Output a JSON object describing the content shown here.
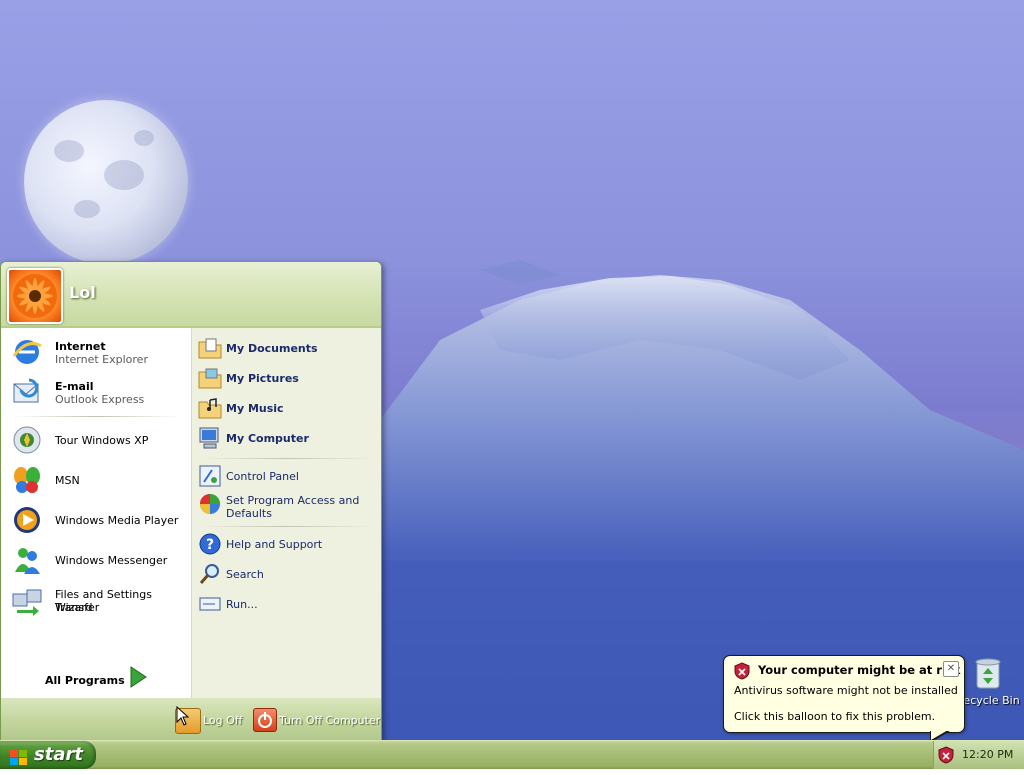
{
  "desktop": {
    "recycle_bin_label": "Recycle Bin"
  },
  "start_menu": {
    "user_name": "Lol",
    "pinned": [
      {
        "title": "Internet",
        "subtitle": "Internet Explorer",
        "icon": "ie-icon"
      },
      {
        "title": "E-mail",
        "subtitle": "Outlook Express",
        "icon": "outlook-express-icon"
      }
    ],
    "recent": [
      {
        "label": "Tour Windows XP",
        "icon": "tour-xp-icon"
      },
      {
        "label": "MSN",
        "icon": "msn-butterfly-icon"
      },
      {
        "label": "Windows Media Player",
        "icon": "media-player-icon"
      },
      {
        "label": "Windows Messenger",
        "icon": "messenger-icon"
      },
      {
        "label": "Files and Settings Transfer",
        "label2": "Wizard",
        "icon": "transfer-wizard-icon"
      }
    ],
    "all_programs_label": "All Programs",
    "places": [
      {
        "label": "My Documents",
        "icon": "folder-documents-icon"
      },
      {
        "label": "My Pictures",
        "icon": "folder-pictures-icon"
      },
      {
        "label": "My Music",
        "icon": "folder-music-icon"
      },
      {
        "label": "My Computer",
        "icon": "my-computer-icon"
      }
    ],
    "settings": [
      {
        "label": "Control Panel",
        "icon": "control-panel-icon"
      },
      {
        "label": "Set Program Access and",
        "label2": "Defaults",
        "icon": "program-access-icon"
      }
    ],
    "tools": [
      {
        "label": "Help and Support",
        "icon": "help-icon"
      },
      {
        "label": "Search",
        "icon": "search-icon"
      },
      {
        "label": "Run...",
        "icon": "run-icon"
      }
    ],
    "log_off_label": "Log Off",
    "turn_off_label": "Turn Off Computer"
  },
  "taskbar": {
    "start_label": "start",
    "clock": "12:20 PM"
  },
  "balloon": {
    "title": "Your computer might be at risk",
    "line1": "Antivirus software might not be installed",
    "line2": "Click this balloon to fix this problem.",
    "close_glyph": "✕"
  },
  "colors": {
    "taskbar_green": "#a4bc73",
    "start_green": "#3f8426",
    "balloon_bg": "#ffffe1",
    "link_blue": "#1b2a6a"
  }
}
